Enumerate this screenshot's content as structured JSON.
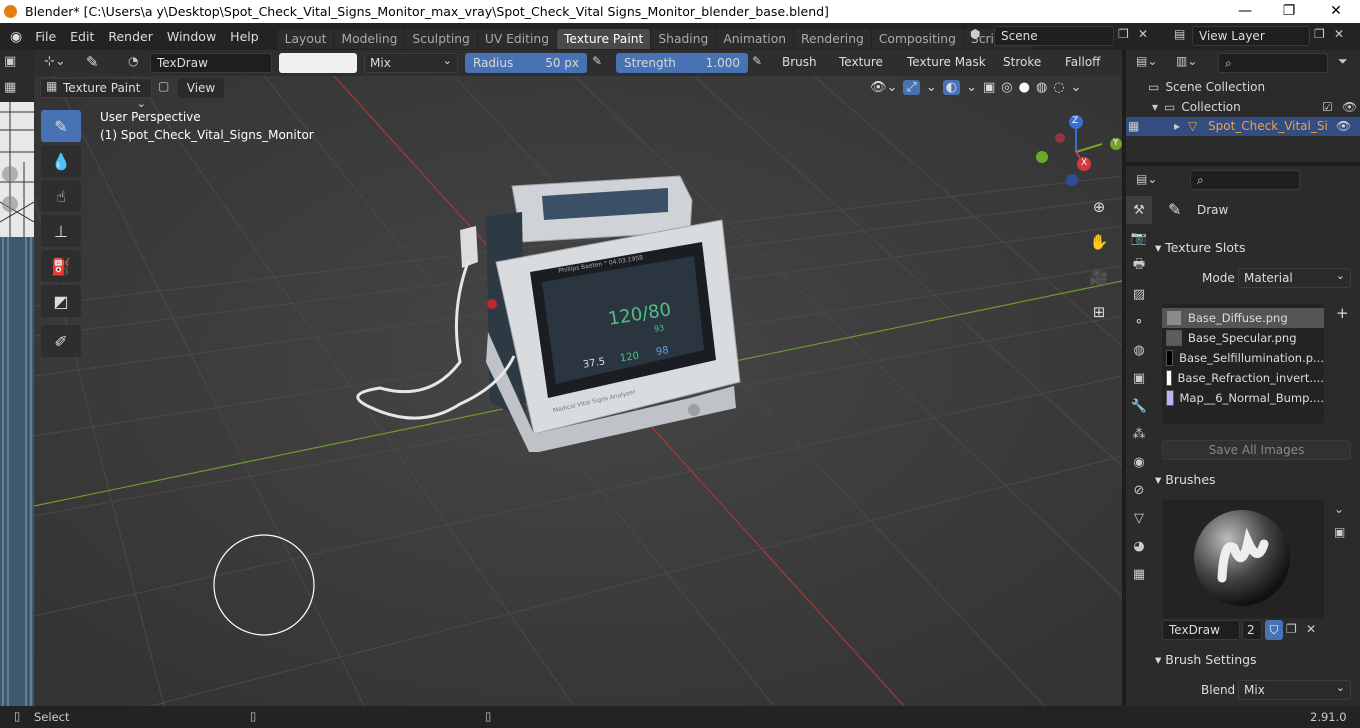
{
  "window": {
    "title": "Blender* [C:\\Users\\a y\\Desktop\\Spot_Check_Vital_Signs_Monitor_max_vray\\Spot_Check_Vital Signs_Monitor_blender_base.blend]",
    "controls": [
      "—",
      "❐",
      "✕"
    ]
  },
  "menu": [
    "File",
    "Edit",
    "Render",
    "Window",
    "Help"
  ],
  "workspaces": [
    "Layout",
    "Modeling",
    "Sculpting",
    "UV Editing",
    "Texture Paint",
    "Shading",
    "Animation",
    "Rendering",
    "Compositing",
    "Scripting"
  ],
  "scene": {
    "name": "Scene",
    "view_layer": "View Layer"
  },
  "tool_header": {
    "brush_name": "TexDraw",
    "blend_mode": "Mix",
    "radius_label": "Radius",
    "radius_value": "50 px",
    "strength_label": "Strength",
    "strength_value": "1.000",
    "strength_fraction": 1.0,
    "menus": [
      "Brush",
      "Texture",
      "Texture Mask",
      "Stroke",
      "Falloff"
    ]
  },
  "mode_header": {
    "mode": "Texture Paint",
    "view": "View"
  },
  "viewport": {
    "perspective": "User Perspective",
    "object_label": "(1) Spot_Check_Vital_Signs_Monitor",
    "device": {
      "brand": "Medical Vital Signs Analyzer",
      "patient": "Phillips Baeten ° 04.03.1958",
      "value_main": "120/80",
      "value_small": "93",
      "temp": "37.5",
      "pulse": "120",
      "spo2": "98"
    },
    "gizmo": {
      "x": "X",
      "y": "Y",
      "z": "Z"
    }
  },
  "outliner": {
    "root": "Scene Collection",
    "collection": "Collection",
    "object": "Spot_Check_Vital_Si"
  },
  "properties": {
    "active_tool": "Draw",
    "texture_slots_title": "Texture Slots",
    "mode_label": "Mode",
    "mode_value": "Material",
    "slots": [
      {
        "name": "Base_Diffuse.png",
        "color": "#8a8a8a"
      },
      {
        "name": "Base_Specular.png",
        "color": "#5d5d5d"
      },
      {
        "name": "Base_Selfillumination.p...",
        "color": "#000000"
      },
      {
        "name": "Base_Refraction_invert....",
        "color": "#ffffff"
      },
      {
        "name": "Map__6_Normal_Bump....",
        "color": "#b8b8f0"
      }
    ],
    "save_all": "Save All Images",
    "brushes_title": "Brushes",
    "brush_name": "TexDraw",
    "brush_users": "2",
    "brush_settings_title": "Brush Settings",
    "blend_label": "Blend",
    "blend_value": "Mix"
  },
  "status": {
    "select": "Select",
    "version": "2.91.0"
  }
}
